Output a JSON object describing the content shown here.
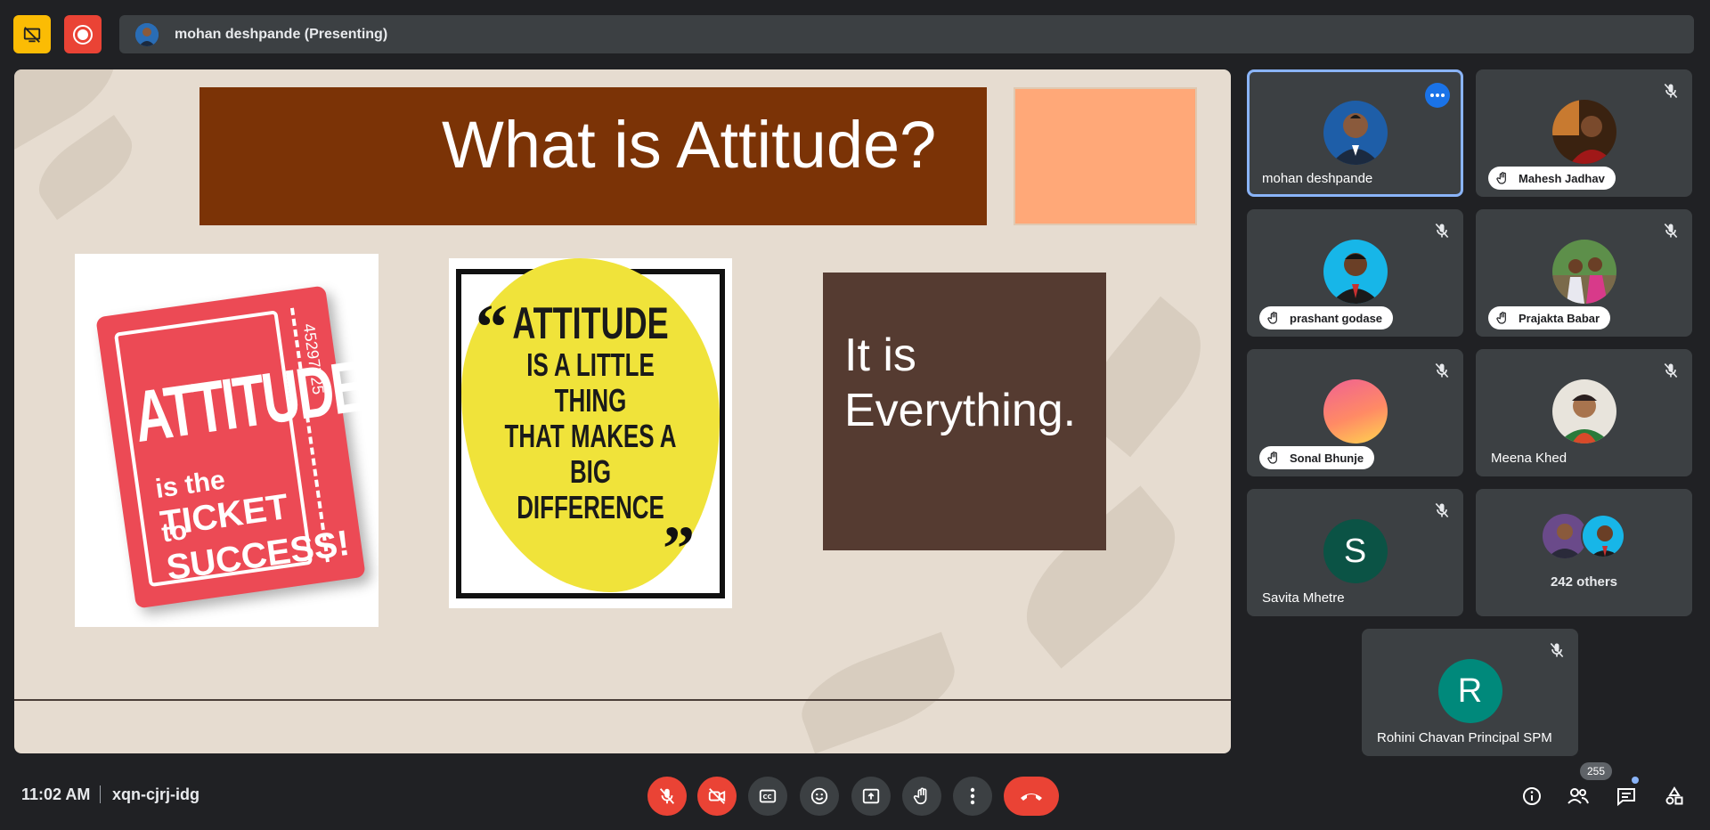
{
  "top": {
    "presenter_label": "mohan deshpande (Presenting)"
  },
  "slide": {
    "title": "What is Attitude?",
    "ticket": {
      "line1": "ATTITUDE",
      "line2a": "is the",
      "line2b": "TICKET",
      "line3a": "to",
      "line3b": "SUCCESS!",
      "number": "45297725"
    },
    "quote": {
      "line1": "ATTITUDE",
      "line2": "IS A LITTLE",
      "line3": "THING",
      "line4": "THAT MAKES A",
      "line5": "BIG",
      "line6": "DIFFERENCE"
    },
    "box_text_line1": "It is",
    "box_text_line2": "Everything."
  },
  "participants": [
    {
      "name": "mohan deshpande"
    },
    {
      "name": "Mahesh Jadhav"
    },
    {
      "name": "prashant godase"
    },
    {
      "name": "Prajakta Babar"
    },
    {
      "name": "Sonal Bhunje"
    },
    {
      "name": "Meena Khed"
    },
    {
      "name": "Savita Mhetre",
      "initial": "S"
    },
    {
      "caption": "242 others"
    },
    {
      "name": "Rohini Chavan Principal SPM",
      "initial": "R"
    }
  ],
  "bottom": {
    "time": "11:02 AM",
    "meeting_code": "xqn-cjrj-idg",
    "people_count": "255"
  },
  "colors": {
    "accent": "#8ab4f8",
    "danger": "#ea4335",
    "warning": "#fbbc04",
    "tile": "#3c4043",
    "background": "#202124"
  }
}
